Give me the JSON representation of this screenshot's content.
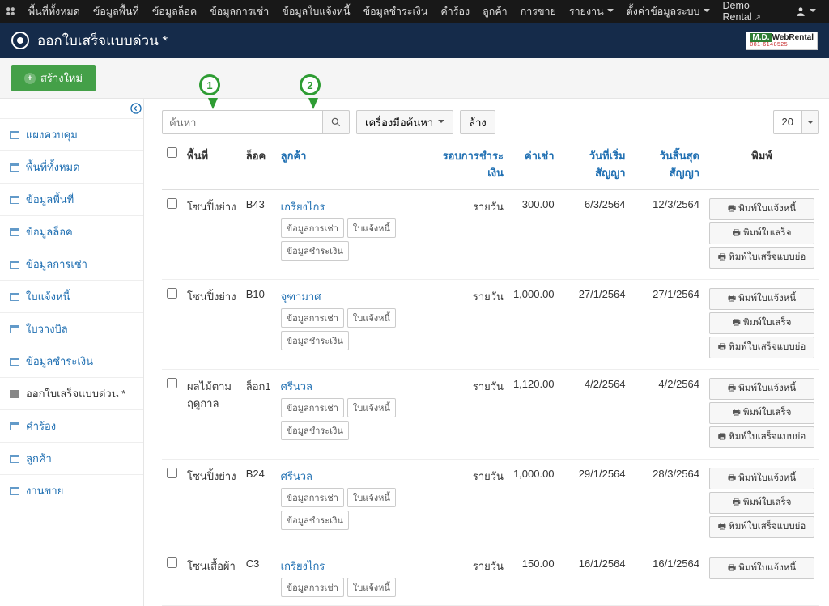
{
  "topnav": {
    "items": [
      {
        "label": "พื้นที่ทั้งหมด"
      },
      {
        "label": "ข้อมูลพื้นที่"
      },
      {
        "label": "ข้อมูลล็อค"
      },
      {
        "label": "ข้อมูลการเช่า"
      },
      {
        "label": "ข้อมูลใบแจ้งหนี้"
      },
      {
        "label": "ข้อมูลชำระเงิน"
      },
      {
        "label": "คำร้อง"
      },
      {
        "label": "ลูกค้า"
      },
      {
        "label": "การขาย"
      },
      {
        "label": "รายงาน",
        "dropdown": true
      },
      {
        "label": "ตั้งค่าข้อมูลระบบ",
        "dropdown": true
      }
    ],
    "sitename": "Demo Rental"
  },
  "page": {
    "title": "ออกใบเสร็จแบบด่วน *"
  },
  "brand": {
    "md": "M.D.",
    "name": "WebRental",
    "sub": "081-6148525"
  },
  "toolbar": {
    "new_label": "สร้างใหม่"
  },
  "sidebar": {
    "items": [
      {
        "label": "แผงควบคุม"
      },
      {
        "label": "พื้นที่ทั้งหมด"
      },
      {
        "label": "ข้อมูลพื้นที่"
      },
      {
        "label": "ข้อมูลล็อค"
      },
      {
        "label": "ข้อมูลการเช่า"
      },
      {
        "label": "ใบแจ้งหนี้"
      },
      {
        "label": "ใบวางบิล"
      },
      {
        "label": "ข้อมูลชำระเงิน"
      },
      {
        "label": "ออกใบเสร็จแบบด่วน *",
        "active": true
      },
      {
        "label": "คำร้อง"
      },
      {
        "label": "ลูกค้า"
      },
      {
        "label": "งานขาย"
      }
    ]
  },
  "filter": {
    "search_placeholder": "ค้นหา",
    "tools_label": "เครื่องมือค้นหา",
    "clear_label": "ล้าง",
    "limit": "20"
  },
  "annotations": {
    "m1": "1",
    "m2": "2"
  },
  "columns": {
    "area": "พื้นที่",
    "lock": "ล็อค",
    "customer": "ลูกค้า",
    "cycle": "รอบการชำระเงิน",
    "rent": "ค่าเช่า",
    "start": "วันที่เริ่มสัญญา",
    "end": "วันสิ้นสุดสัญญา",
    "print": "พิมพ์"
  },
  "chips": {
    "rent": "ข้อมูลการเช่า",
    "invoice": "ใบแจ้งหนี้",
    "payment": "ข้อมูลชำระเงิน"
  },
  "prints": {
    "invoice": "พิมพ์ใบแจ้งหนี้",
    "receipt": "พิมพ์ใบเสร็จ",
    "receipt_short": "พิมพ์ใบเสร็จแบบย่อ"
  },
  "rows": [
    {
      "area": "โซนปิ้งย่าง",
      "lock": "B43",
      "customer": "เกรียงไกร",
      "cycle": "รายวัน",
      "rent": "300.00",
      "start": "6/3/2564",
      "end": "12/3/2564",
      "chips": [
        "rent",
        "invoice",
        "payment"
      ],
      "prints": [
        "invoice",
        "receipt",
        "receipt_short"
      ]
    },
    {
      "area": "โซนปิ้งย่าง",
      "lock": "B10",
      "customer": "จุฑามาศ",
      "cycle": "รายวัน",
      "rent": "1,000.00",
      "start": "27/1/2564",
      "end": "27/1/2564",
      "chips": [
        "rent",
        "invoice",
        "payment"
      ],
      "prints": [
        "invoice",
        "receipt",
        "receipt_short"
      ]
    },
    {
      "area": "ผลไม้ตามฤดูกาล",
      "lock": "ล็อก1",
      "customer": "ศรีนวล",
      "cycle": "รายวัน",
      "rent": "1,120.00",
      "start": "4/2/2564",
      "end": "4/2/2564",
      "chips": [
        "rent",
        "invoice",
        "payment"
      ],
      "prints": [
        "invoice",
        "receipt",
        "receipt_short"
      ]
    },
    {
      "area": "โซนปิ้งย่าง",
      "lock": "B24",
      "customer": "ศรีนวล",
      "cycle": "รายวัน",
      "rent": "1,000.00",
      "start": "29/1/2564",
      "end": "28/3/2564",
      "chips": [
        "rent",
        "invoice",
        "payment"
      ],
      "prints": [
        "invoice",
        "receipt",
        "receipt_short"
      ]
    },
    {
      "area": "โซนเสื้อผ้า",
      "lock": "C3",
      "customer": "เกรียงไกร",
      "cycle": "รายวัน",
      "rent": "150.00",
      "start": "16/1/2564",
      "end": "16/1/2564",
      "chips": [
        "rent",
        "invoice"
      ],
      "prints": [
        "invoice"
      ]
    }
  ]
}
